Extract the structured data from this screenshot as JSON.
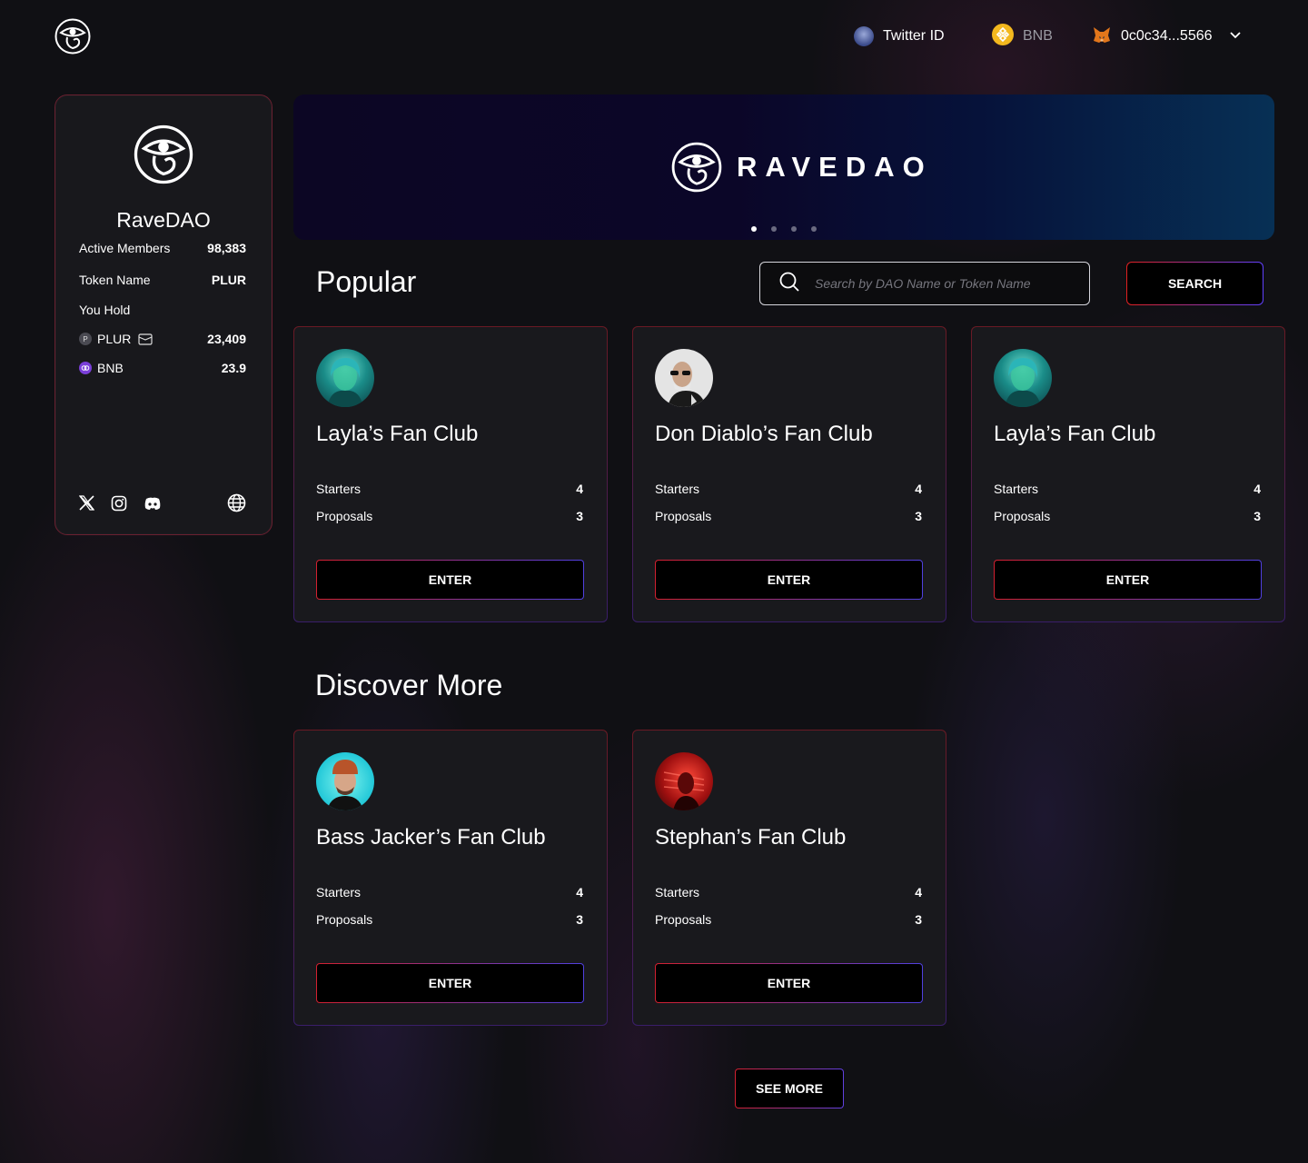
{
  "header": {
    "twitter_label": "Twitter ID",
    "network_label": "BNB",
    "wallet_address": "0c0c34...5566",
    "icons": [
      "eye-logo-icon",
      "twitter-avatar",
      "bnb-icon",
      "metamask-fox-icon",
      "chevron-down-icon"
    ]
  },
  "sidebar": {
    "name": "RaveDAO",
    "active_members_label": "Active Members",
    "active_members_value": "98,383",
    "token_name_label": "Token Name",
    "token_name_value": "PLUR",
    "you_hold_label": "You Hold",
    "holdings": [
      {
        "token": "PLUR",
        "icon_letter": "P",
        "amount": "23,409"
      },
      {
        "token": "BNB",
        "amount": "23.9"
      }
    ],
    "socials": [
      "x-icon",
      "instagram-icon",
      "discord-icon",
      "globe-icon"
    ]
  },
  "banner": {
    "wordmark": "RAVEDAO",
    "slides": 4,
    "active_slide": 1
  },
  "popular": {
    "title": "Popular",
    "search_placeholder": "Search by DAO Name or Token Name",
    "search_button": "SEARCH",
    "cards": [
      {
        "title": "Layla’s Fan Club",
        "starters_label": "Starters",
        "starters": "4",
        "proposals_label": "Proposals",
        "proposals": "3",
        "button": "ENTER"
      },
      {
        "title": "Don Diablo’s Fan Club",
        "starters_label": "Starters",
        "starters": "4",
        "proposals_label": "Proposals",
        "proposals": "3",
        "button": "ENTER"
      },
      {
        "title": "Layla’s Fan Club",
        "starters_label": "Starters",
        "starters": "4",
        "proposals_label": "Proposals",
        "proposals": "3",
        "button": "ENTER"
      }
    ]
  },
  "discover": {
    "title": "Discover More",
    "cards": [
      {
        "title": "Bass Jacker’s Fan Club",
        "starters_label": "Starters",
        "starters": "4",
        "proposals_label": "Proposals",
        "proposals": "3",
        "button": "ENTER"
      },
      {
        "title": "Stephan’s Fan Club",
        "starters_label": "Starters",
        "starters": "4",
        "proposals_label": "Proposals",
        "proposals": "3",
        "button": "ENTER"
      }
    ],
    "see_more": "SEE MORE"
  },
  "colors": {
    "background": "#101014",
    "card": "#19191d",
    "accent_red": "#d22030",
    "accent_purple": "#5040e0"
  }
}
